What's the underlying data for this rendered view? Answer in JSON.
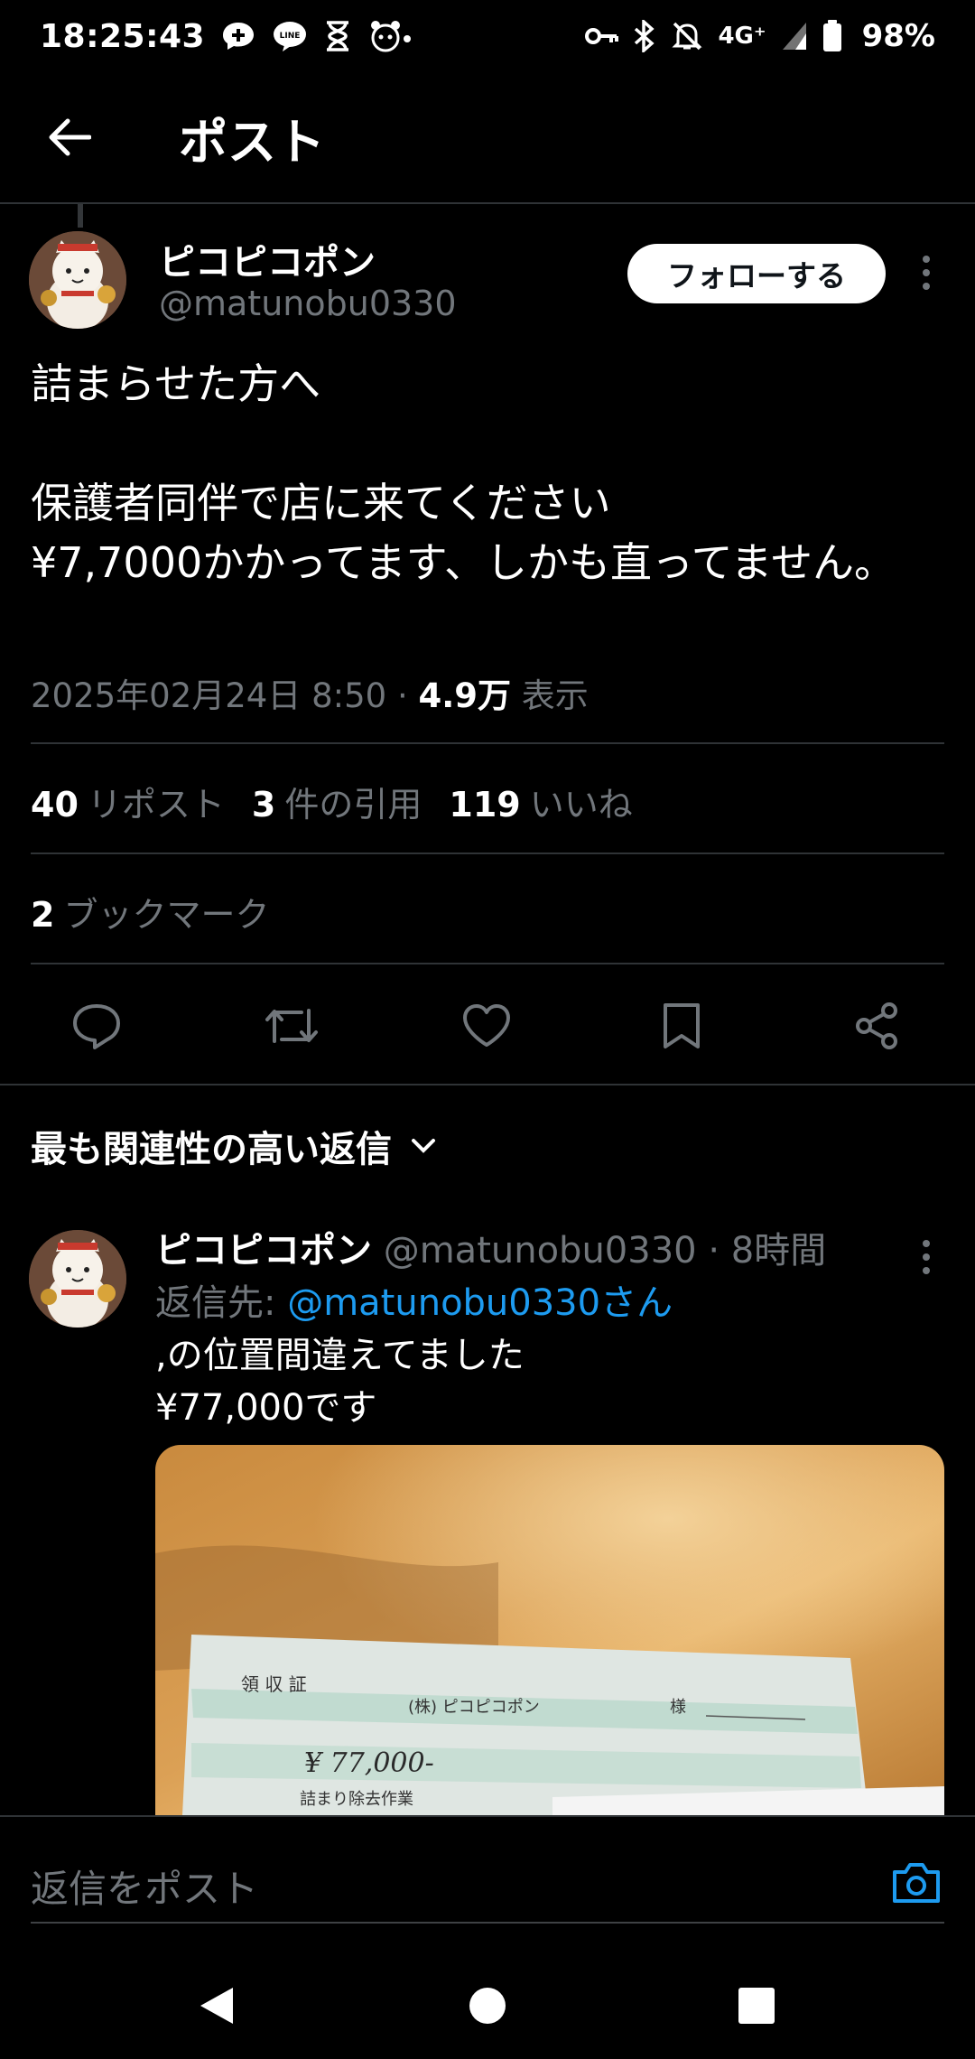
{
  "status_bar": {
    "time": "18:25:43",
    "network": "4G⁺",
    "battery": "98%",
    "icons": [
      "messenger-icon",
      "line-icon",
      "hourglass-icon",
      "cat-app-icon",
      "key-icon",
      "bluetooth-icon",
      "mute-icon",
      "signal-icon",
      "battery-icon"
    ]
  },
  "header": {
    "title": "ポスト",
    "back_icon": "back-arrow-icon"
  },
  "post": {
    "author_name": "ピコピコポン",
    "author_handle": "@matunobu0330",
    "follow_label": "フォローする",
    "text": "詰まらせた方へ\n\n保護者同伴で店に来てください\n¥7,7000かかってます、しかも直ってません。",
    "timestamp": "2025年02月24日 8:50",
    "separator": "·",
    "views_count": "4.9万",
    "views_label": "表示",
    "reposts_count": "40",
    "reposts_label": "リポスト",
    "quotes_count": "3",
    "quotes_label": "件の引用",
    "likes_count": "119",
    "likes_label": "いいね",
    "bookmarks_count": "2",
    "bookmarks_label": "ブックマーク"
  },
  "actions": [
    "reply-icon",
    "repost-icon",
    "like-icon",
    "bookmark-icon",
    "share-icon"
  ],
  "replies_section": {
    "header": "最も関連性の高い返信"
  },
  "reply": {
    "author_name": "ピコピコポン",
    "author_handle": "@matunobu0330",
    "time_ago": "· 8時間",
    "reply_to_label": "返信先: ",
    "reply_to_mention": "@matunobu0330さん",
    "text": ",の位置間違えてました\n¥77,000です",
    "image_alt": "receipt photo"
  },
  "composer": {
    "placeholder": "返信をポスト"
  },
  "colors": {
    "background": "#000000",
    "accent": "#1d9bf0",
    "muted": "#71767b",
    "divider": "#2f3336"
  }
}
